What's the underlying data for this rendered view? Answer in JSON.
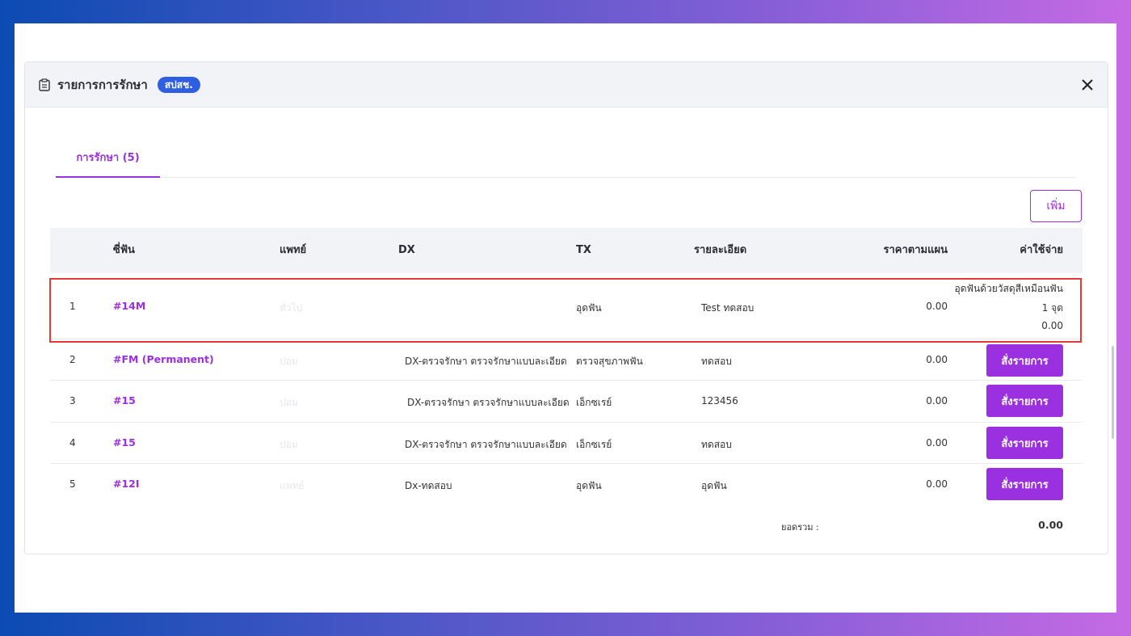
{
  "modal": {
    "title": "รายการการรักษา",
    "badge": "สปสช.",
    "tab_label": "การรักษา (5)",
    "add_label": "เพิ่ม"
  },
  "columns": {
    "tooth": "ซี่ฟัน",
    "doctor": "แพทย์",
    "dx": "DX",
    "tx": "TX",
    "detail": "รายละเอียด",
    "plan_price": "ราคาตามแผน",
    "cost": "ค่าใช้จ่าย"
  },
  "rows": [
    {
      "no": "1",
      "tooth": "#14M",
      "doctor": "ทั่วไป",
      "dx": "",
      "tx": "อุดฟัน",
      "detail": "Test ทดสอบ",
      "price": "0.00",
      "cost_lines": [
        "อุดฟันด้วยวัสดุสีเหมือนฟัน",
        "1 จุด",
        "0.00"
      ]
    },
    {
      "no": "2",
      "tooth": "#FM (Permanent)",
      "doctor": "ปอม",
      "dx": "DX-ตรวจรักษา ตรวจรักษาแบบละเอียด",
      "tx": "ตรวจสุขภาพฟัน",
      "detail": "ทดสอบ",
      "price": "0.00",
      "action": "สั่งรายการ"
    },
    {
      "no": "3",
      "tooth": "#15",
      "doctor": "ปอม",
      "dx": "DX-ตรวจรักษา ตรวจรักษาแบบละเอียด",
      "tx": "เอ็กซเรย์",
      "detail": "123456",
      "price": "0.00",
      "action": "สั่งรายการ"
    },
    {
      "no": "4",
      "tooth": "#15",
      "doctor": "ปอม",
      "dx": "DX-ตรวจรักษา ตรวจรักษาแบบละเอียด",
      "tx": "เอ็กซเรย์",
      "detail": "ทดสอบ",
      "price": "0.00",
      "action": "สั่งรายการ"
    },
    {
      "no": "5",
      "tooth": "#12I",
      "doctor": "แพทย์",
      "dx": "Dx-ทดสอบ",
      "tx": "อุดฟัน",
      "detail": "อุดฟัน",
      "price": "0.00",
      "action": "สั่งรายการ"
    }
  ],
  "total": {
    "label": "ยอดรวม :",
    "value": "0.00"
  },
  "colors": {
    "accent": "#9b30e0",
    "badge": "#2f5ee0",
    "highlight": "#e53935"
  }
}
